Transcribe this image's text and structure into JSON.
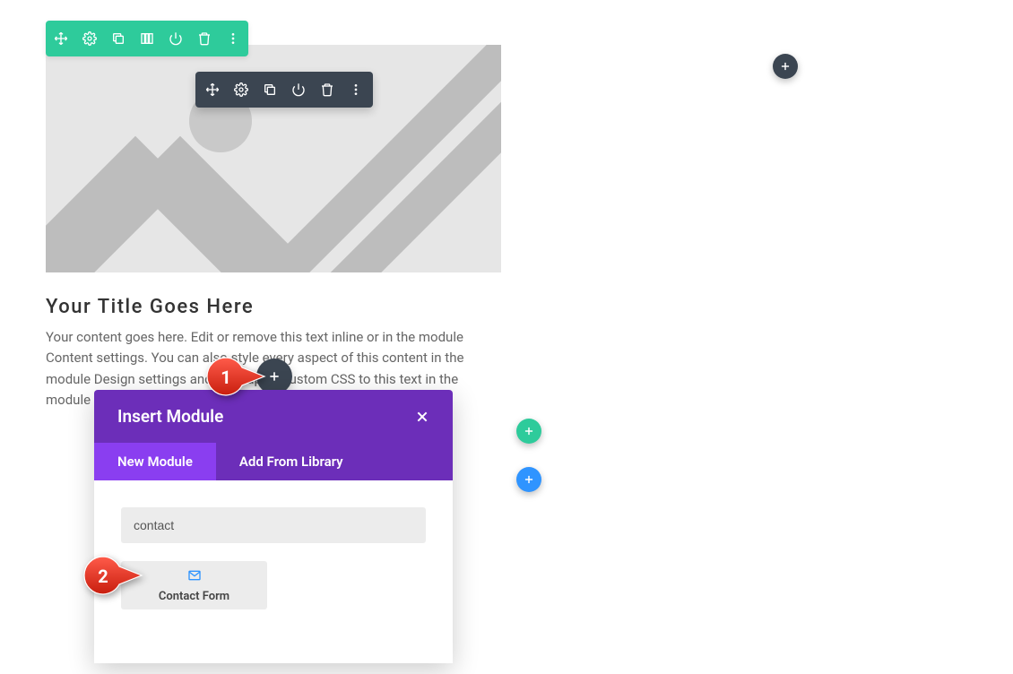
{
  "section_toolbar": {
    "icons": [
      "move-icon",
      "settings-icon",
      "duplicate-icon",
      "columns-icon",
      "power-icon",
      "delete-icon",
      "more-icon"
    ]
  },
  "module_toolbar": {
    "icons": [
      "move-icon",
      "settings-icon",
      "duplicate-icon",
      "power-icon",
      "delete-icon",
      "more-icon"
    ]
  },
  "content": {
    "title": "Your Title Goes Here",
    "body": "Your content goes here. Edit or remove this text inline or in the module Content settings. You can also style every aspect of this content in the module Design settings and even apply custom CSS to this text in the module Advanced settings."
  },
  "modal": {
    "title": "Insert Module",
    "tabs": {
      "new": "New Module",
      "library": "Add From Library"
    },
    "search_value": "contact",
    "result": {
      "label": "Contact Form"
    }
  },
  "markers": {
    "one": "1",
    "two": "2"
  }
}
